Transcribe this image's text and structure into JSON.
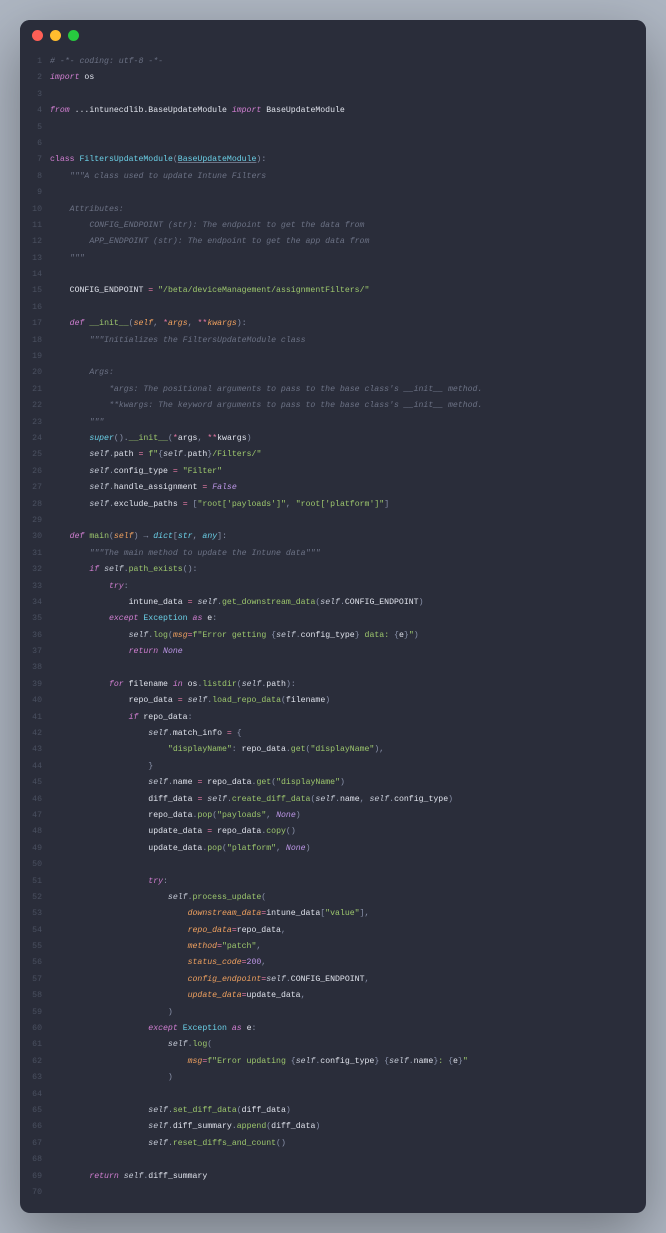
{
  "window": {
    "controls": [
      "close",
      "minimize",
      "zoom"
    ]
  },
  "editor": {
    "lineCount": 70,
    "language": "python",
    "lines": {
      "1": "# -*- coding: utf-8 -*-",
      "2_import": "import",
      "2_os": "os",
      "4_from": "from",
      "4_path": "...intunecdlib.BaseUpdateModule",
      "4_import": "import",
      "4_name": "BaseUpdateModule",
      "7_class": "class",
      "7_name": "FiltersUpdateModule",
      "7_base": "BaseUpdateModule",
      "8_doc": "\"\"\"A class used to update Intune Filters",
      "10_doc": "Attributes:",
      "11_doc": "CONFIG_ENDPOINT (str): The endpoint to get the data from",
      "12_doc": "APP_ENDPOINT (str): The endpoint to get the app data from",
      "13_doc": "\"\"\"",
      "15_const": "CONFIG_ENDPOINT",
      "15_val": "\"/beta/deviceManagement/assignmentFilters/\"",
      "17_def": "def",
      "17_name": "__init__",
      "17_self": "self",
      "17_args": "*args",
      "17_kwargs": "**kwargs",
      "18_doc": "\"\"\"Initializes the FiltersUpdateModule class",
      "20_doc": "Args:",
      "21_doc": "*args: The positional arguments to pass to the base class's __init__ method.",
      "22_doc": "**kwargs: The keyword arguments to pass to the base class's __init__ method.",
      "23_doc": "\"\"\"",
      "24_super": "super",
      "24_init": "__init__",
      "25_path": "path",
      "25_str_a": "f\"",
      "25_str_b": "/Filters/\"",
      "26_ct": "config_type",
      "26_val": "\"Filter\"",
      "27_ha": "handle_assignment",
      "27_val": "False",
      "28_ep": "exclude_paths",
      "28_v1": "\"root['payloads']\"",
      "28_v2": "\"root['platform']\"",
      "30_def": "def",
      "30_name": "main",
      "30_ret_dict": "dict",
      "30_ret_str": "str",
      "30_ret_any": "any",
      "31_doc": "\"\"\"The main method to update the Intune data\"\"\"",
      "32_if": "if",
      "32_pe": "path_exists",
      "33_try": "try",
      "34_id": "intune_data",
      "34_gdd": "get_downstream_data",
      "34_ce": "CONFIG_ENDPOINT",
      "35_except": "except",
      "35_exc": "Exception",
      "35_as": "as",
      "35_e": "e",
      "36_log": "log",
      "36_msg": "msg",
      "36_s1": "f\"Error getting ",
      "36_s2": " data: ",
      "36_s3": "\"",
      "37_ret": "return",
      "37_none": "None",
      "39_for": "for",
      "39_fn": "filename",
      "39_in": "in",
      "39_ld": "listdir",
      "40_rd": "repo_data",
      "40_lrd": "load_repo_data",
      "41_if": "if",
      "42_mi": "match_info",
      "43_dn": "\"displayName\"",
      "43_get": "get",
      "45_name": "name",
      "46_dd": "diff_data",
      "46_cdd": "create_diff_data",
      "47_pop": "pop",
      "47_pl": "\"payloads\"",
      "48_ud": "update_data",
      "48_copy": "copy",
      "49_plat": "\"platform\"",
      "51_try": "try",
      "52_pu": "process_update",
      "53_dsd": "downstream_data",
      "53_val": "\"value\"",
      "54_rd": "repo_data",
      "55_method": "method",
      "55_v": "\"patch\"",
      "56_sc": "status_code",
      "56_v": "200",
      "57_ce": "config_endpoint",
      "58_ud": "update_data",
      "60_except": "except",
      "62_s1": "f\"Error updating ",
      "62_s2": " ",
      "62_s3": ": ",
      "62_s4": "\"",
      "65_sdd": "set_diff_data",
      "66_ds": "diff_summary",
      "66_app": "append",
      "67_rdc": "reset_diffs_and_count",
      "69_ret": "return"
    }
  }
}
